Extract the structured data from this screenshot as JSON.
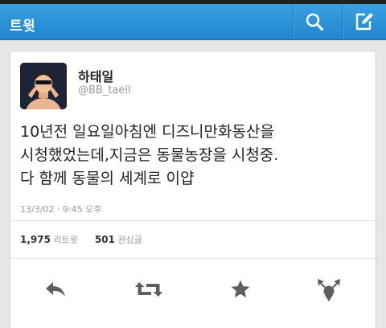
{
  "topbar": {
    "title": "트윗",
    "bg_color": "#2a95d9"
  },
  "tweet": {
    "display_name": "하태일",
    "handle": "@BB_taeil",
    "text_lines": [
      "10년전 일요일아침엔 디즈니만화동산을",
      "시청했었는데,지금은 동물농장을 시청중.",
      "다 함께 동물의 세계로 이얍"
    ],
    "timestamp": "13/3/02 · 9:45 오후",
    "retweets_count": "1,975",
    "retweets_label": "리트윗",
    "favorites_count": "501",
    "favorites_label": "관심글"
  },
  "icons": {
    "search": "search-icon",
    "compose": "compose-icon",
    "reply": "reply-icon",
    "retweet": "retweet-icon",
    "favorite": "star-icon",
    "share": "share-icon"
  }
}
